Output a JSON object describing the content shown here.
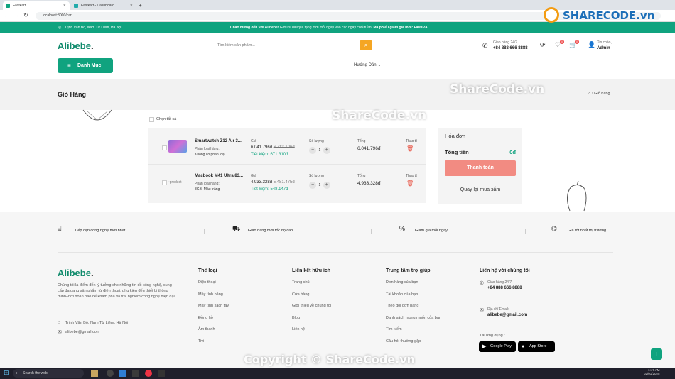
{
  "browser": {
    "tabs": [
      {
        "label": "Fastkart",
        "active": true
      },
      {
        "label": "Fastkart - Dashboard",
        "active": false
      }
    ],
    "new_tab": "+",
    "url": "localhost:3000/cart"
  },
  "topbar": {
    "address": "Trịnh Văn Bô, Nam Từ Liêm, Hà Nội",
    "welcome_bold": "Chào mừng đến với Alibebe!",
    "welcome_text": " Giờ ưu đãi/quà tặng mới mỗi ngày vào các ngày cuối tuần. ",
    "coupon_bold": "Mã phiếu giảm giá mới: Fast024"
  },
  "header": {
    "logo_main": "Alibebe",
    "logo_dot": ".",
    "search_placeholder": "Tìm kiếm sản phẩm...",
    "hotline_label": "Giao hàng 24/7",
    "hotline_number": "+84 888 666 8888",
    "wishlist_badge": "0",
    "cart_badge": "0",
    "greeting": "Xin chào,",
    "user": "Admin",
    "category_button": "Danh Mục",
    "guide_menu": "Hướng Dẫn"
  },
  "banner": {
    "title": "Giỏ Hàng",
    "breadcrumb": "Giỏ hàng"
  },
  "cart": {
    "select_all": "Chọn tất cả",
    "items": [
      {
        "name": "Smartwatch Z12 Air 3...",
        "variant_label": "Phân loại hàng:",
        "variant": "Không có phân loại",
        "price_label": "Giá",
        "price": "6.041.796đ",
        "old_price": "6.713.106đ",
        "saving": "Tiết kiệm: 671.310đ",
        "qty_label": "Số lượng",
        "qty": "1",
        "total_label": "Tổng",
        "total": "6.041.796đ",
        "action_label": "Thao tá",
        "image_alt": ""
      },
      {
        "name": "Macbook M41 Ultra 83...",
        "variant_label": "Phân loại hàng:",
        "variant": "8GB, Màu trắng",
        "price_label": "Giá",
        "price": "4.933.328đ",
        "old_price": "5.481.475đ",
        "saving": "Tiết kiệm: 548.147đ",
        "qty_label": "Số lượng",
        "qty": "1",
        "total_label": "Tổng",
        "total": "4.933.328đ",
        "action_label": "Thao tá",
        "image_alt": "product"
      }
    ],
    "minus": "−",
    "plus": "+"
  },
  "invoice": {
    "title": "Hóa đơn",
    "total_label": "Tổng tiền",
    "total_value": "0đ",
    "pay_button": "Thanh toán",
    "continue": "Quay lại mua sắm"
  },
  "features": [
    {
      "label": "Tiếp cận công nghệ mới nhất",
      "icon": "tech-icon"
    },
    {
      "label": "Giao hàng mới tốc độ cao",
      "icon": "truck-icon"
    },
    {
      "label": "Giảm giá mỗi ngày",
      "icon": "discount-icon"
    },
    {
      "label": "Giá tốt nhất thị trường",
      "icon": "price-icon"
    }
  ],
  "footer": {
    "about": "Chúng tôi là điểm đến lý tưởng cho những tín đồ công nghệ, cung cấp đa dạng sản phẩm từ điện thoại, phụ kiện đến thiết bị thông minh–nơi hoàn hảo để khám phá và trải nghiệm công nghệ hiện đại.",
    "address": "Trịnh Văn Bô, Nam Từ Liêm, Hà Nội",
    "email": "alibebe@gmail.com",
    "columns": [
      {
        "title": "Thể loại",
        "links": [
          "Điện thoại",
          "Máy tính bảng",
          "Máy tính xách tay",
          "Đồng hồ",
          "Âm thanh",
          "Tivi"
        ]
      },
      {
        "title": "Liên kết hữu ích",
        "links": [
          "Trang chủ",
          "Cửa hàng",
          "Giới thiệu về chúng tôi",
          "Blog",
          "Liên hệ"
        ]
      },
      {
        "title": "Trung tâm trợ giúp",
        "links": [
          "Đơn hàng của bạn",
          "Tài khoản của bạn",
          "Theo dõi đơn hàng",
          "Danh sách mong muốn của bạn",
          "Tìm kiếm",
          "Câu hỏi thường gặp"
        ]
      }
    ],
    "contact": {
      "title": "Liên hệ với chúng tôi",
      "hotline_label": "Giao hàng 24/7",
      "hotline": "+84 888 666 8888",
      "email_label": "Địa chỉ Email:",
      "email": "alibebe@gmail.com",
      "apps_label": "Tải ứng dụng :",
      "google_play": "Google Play",
      "app_store": "App Store"
    }
  },
  "watermarks": {
    "logo": "SHARECODE.vn",
    "mid1": "ShareCode.vn",
    "mid2": "ShareCode.vn",
    "bottom": "Copyright © ShareCode.vn"
  },
  "taskbar": {
    "search": "Search the web",
    "time": "1:47 AM",
    "date": "02/01/2025"
  },
  "colors": {
    "brand": "#10a37f",
    "danger": "#f28b82",
    "accent": "#f5a623"
  }
}
